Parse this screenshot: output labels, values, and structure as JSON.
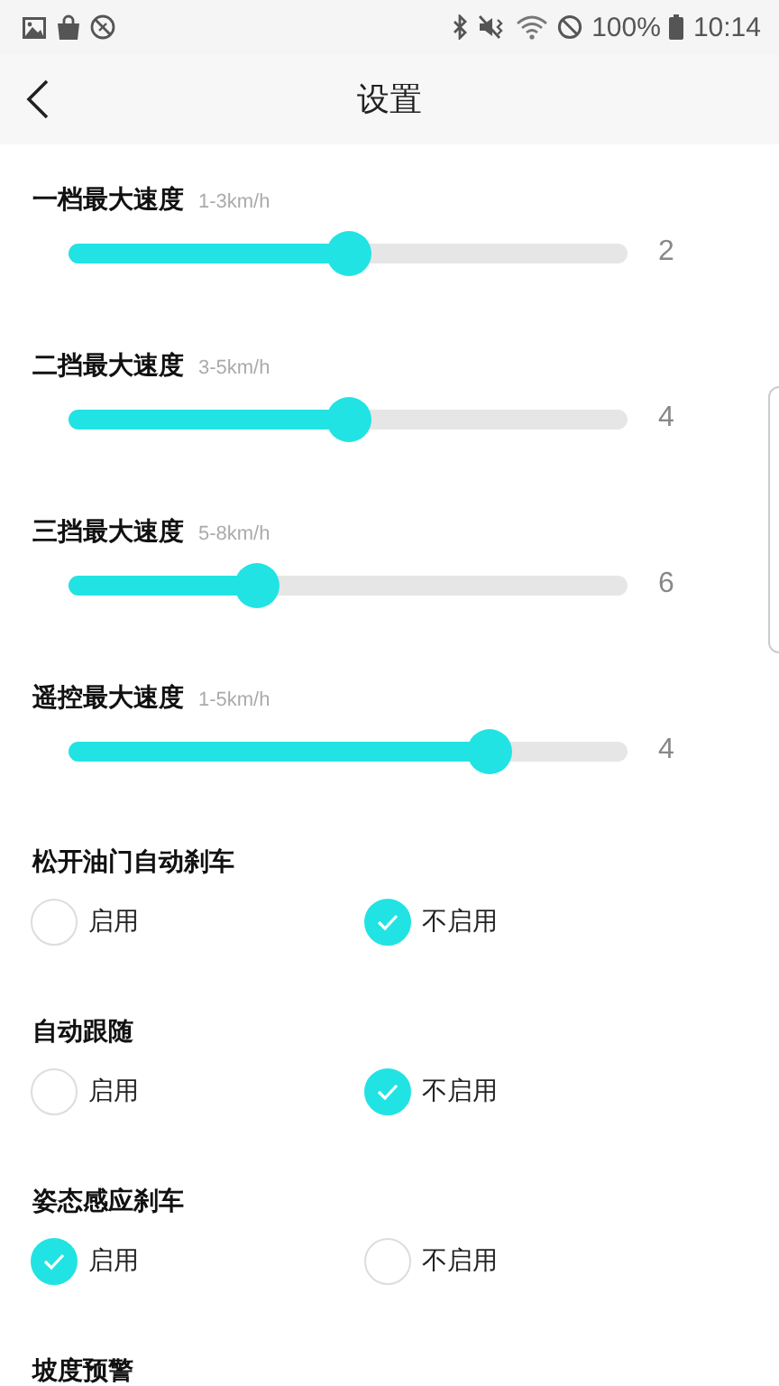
{
  "status_bar": {
    "battery": "100%",
    "time": "10:14"
  },
  "header": {
    "title": "设置"
  },
  "sliders": [
    {
      "label": "一档最大速度",
      "range": "1-3km/h",
      "level": 0.5,
      "value": "2"
    },
    {
      "label": "二挡最大速度",
      "range": "3-5km/h",
      "level": 0.5,
      "value": "4"
    },
    {
      "label": "三挡最大速度",
      "range": "5-8km/h",
      "level": 0.335,
      "value": "6"
    },
    {
      "label": "遥控最大速度",
      "range": "1-5km/h",
      "level": 0.75,
      "value": "4"
    }
  ],
  "options": [
    {
      "title": "松开油门自动刹车",
      "choices": [
        {
          "label": "启用",
          "selected": false
        },
        {
          "label": "不启用",
          "selected": true
        }
      ]
    },
    {
      "title": "自动跟随",
      "choices": [
        {
          "label": "启用",
          "selected": false
        },
        {
          "label": "不启用",
          "selected": true
        }
      ]
    },
    {
      "title": "姿态感应刹车",
      "choices": [
        {
          "label": "启用",
          "selected": true
        },
        {
          "label": "不启用",
          "selected": false
        }
      ]
    },
    {
      "title": "坡度预警"
    }
  ]
}
